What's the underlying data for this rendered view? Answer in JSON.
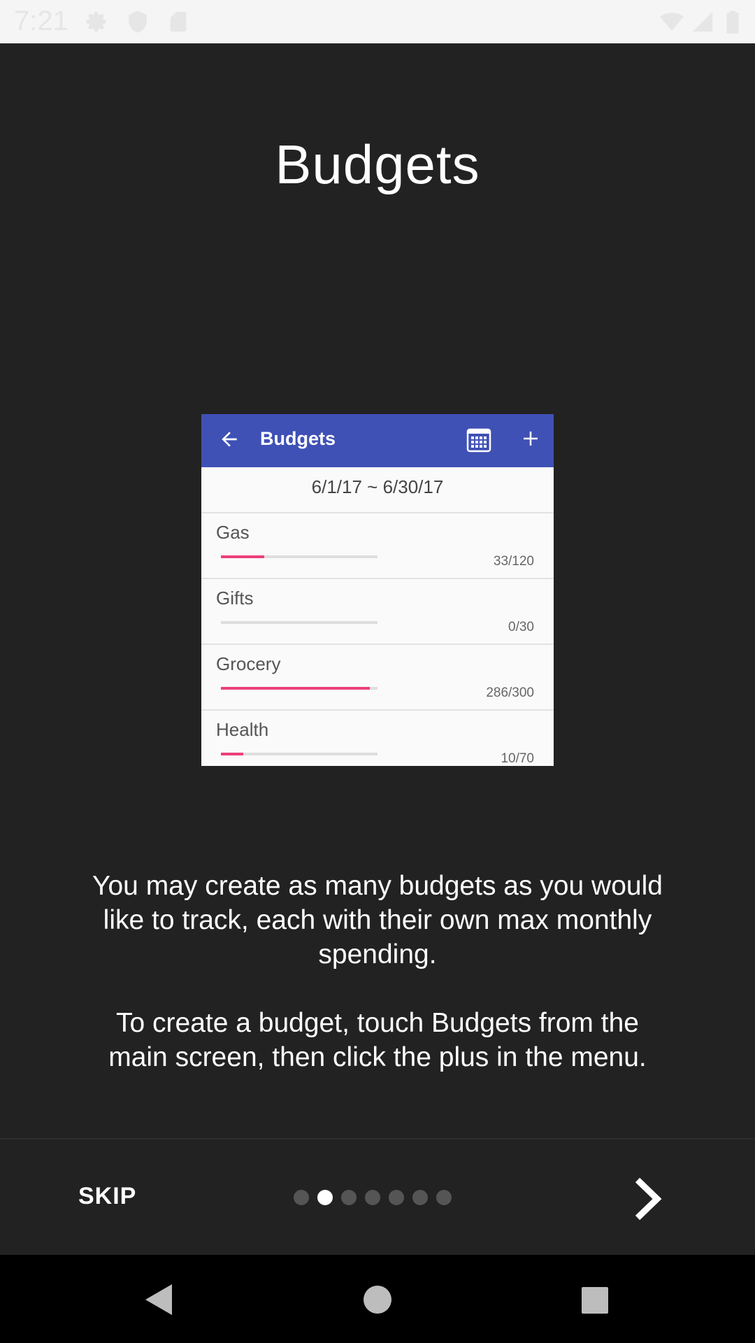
{
  "status_bar": {
    "time": "7:21",
    "icons": [
      "settings-icon",
      "shield-icon",
      "sd-card-icon",
      "wifi-icon",
      "signal-icon",
      "battery-icon"
    ]
  },
  "onboarding": {
    "title": "Budgets",
    "description_1": "You may create as many budgets as you would like to track, each with their own max monthly spending.",
    "description_2": "To create a budget, touch Budgets from the main screen, then click the plus in the menu."
  },
  "preview": {
    "appbar_title": "Budgets",
    "appbar_color": "#3f51b5",
    "accent_color": "#ec407a",
    "date_range": "6/1/17 ~ 6/30/17",
    "budgets": [
      {
        "name": "Gas",
        "amount": "33/120",
        "progress": 0.275
      },
      {
        "name": "Gifts",
        "amount": "0/30",
        "progress": 0
      },
      {
        "name": "Grocery",
        "amount": "286/300",
        "progress": 0.953
      },
      {
        "name": "Health",
        "amount": "10/70",
        "progress": 0.143
      }
    ]
  },
  "bottom_bar": {
    "skip_label": "SKIP",
    "page_count": 7,
    "current_page": 2
  },
  "nav_bar": {
    "buttons": [
      "back-icon",
      "home-icon",
      "recents-icon"
    ]
  }
}
